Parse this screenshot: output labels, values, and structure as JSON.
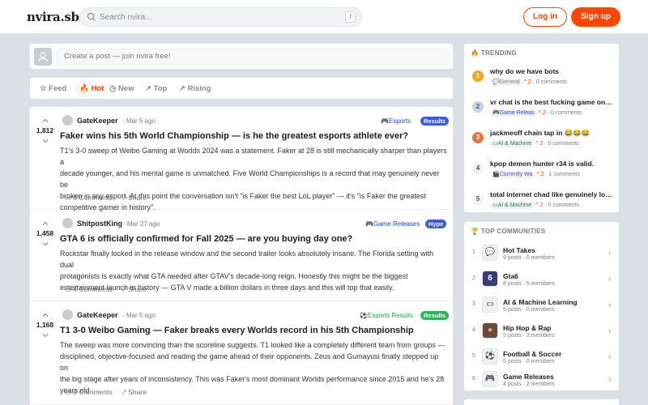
{
  "header": {
    "logo": "nvira.sbs",
    "search_placeholder": "Search nvira...",
    "search_shortcut": "/",
    "login_label": "Log in",
    "signup_label": "Sign up",
    "accent": "#ff4500"
  },
  "create_post": {
    "placeholder": "Create a post — join nvira free!"
  },
  "sort_tabs": [
    {
      "label": "Feed",
      "icon": "star-icon"
    },
    {
      "label": "Hot",
      "icon": "flame-icon",
      "active": true
    },
    {
      "label": "New",
      "icon": "clock-icon"
    },
    {
      "label": "Top",
      "icon": "trend-icon"
    },
    {
      "label": "Rising",
      "icon": "rising-icon"
    }
  ],
  "posts": [
    {
      "votes": "1,812",
      "author": "GateKeeper",
      "time": "· Mar 5 ago",
      "category": "Esports",
      "category_icon": "gamepad-icon",
      "badge": "Results",
      "badge_color": "#3b5bdb",
      "title": "Faker wins his 5th World Championship — is he the greatest esports athlete ever?",
      "body_lines": [
        "T1's 3-0 sweep of Weibo Gaming at Worlds 2024 was a statement. Faker at 28 is still mechanically sharper than players a",
        "decade younger, and his mental game is unmatched. Five World Championships is a record that may genuinely never be",
        "broken in any esport. At this point the conversation isn't \"is Faker the best LoL player\" — it's \"is Faker the greatest",
        "competitive gamer in history\"."
      ],
      "comments": "0 Comments",
      "share": "Share"
    },
    {
      "votes": "1,458",
      "author": "ShitpostKing",
      "time": "· Mar 27 ago",
      "category": "Game Releases",
      "category_icon": "gamepad-icon",
      "badge": "Hype",
      "badge_color": "#3b5bdb",
      "title": "GTA 6 is officially confirmed for Fall 2025 — are you buying day one?",
      "body_lines": [
        "Rockstar finally locked in the release window and the second trailer looks absolutely insane. The Florida setting with dual",
        "protagonists is exactly what GTA needed after GTAV's decade-long reign. Honestly this might be the biggest",
        "entertainment launch in history — GTA V made a billion dollars in three days and this will top that easily."
      ],
      "comments": "4 Comments",
      "share": "Share"
    },
    {
      "votes": "1,168",
      "author": "GateKeeper",
      "time": "· Mar 5 ago",
      "category": "Esports Results",
      "category_icon": "soccer-ball-icon",
      "badge": "Results",
      "badge_color": "#2fb35a",
      "title": "T1 3-0 Weibo Gaming — Faker breaks every Worlds record in his 5th Championship",
      "body_lines": [
        "The sweep was more convincing than the scoreline suggests. T1 looked like a completely different team from groups —",
        "disciplined, objective-focused and reading the game ahead of their opponents. Zeus and Gumayusi finally stepped up on",
        "the big stage after years of inconsistency. This was Faker's most dominant Worlds performance since 2015 and he's 28",
        "years old."
      ],
      "comments": "0 Comments",
      "share": "Share"
    }
  ],
  "trending": {
    "heading": "TRENDING",
    "items": [
      {
        "rank": "1",
        "title": "why do we have bots",
        "tag": "General",
        "tag_icon": "speech-icon",
        "score": "^ 2",
        "comments": "· 0 comments",
        "rank_bg": "#f5a623",
        "rank_fg": "#ffffff"
      },
      {
        "rank": "2",
        "title": "vr chat is the best fucking game on t...",
        "tag": "Game Releas",
        "tag_icon": "gamepad-icon",
        "score": "^ 2",
        "comments": "· 0 comments",
        "rank_bg": "#c9d3e6",
        "rank_fg": "#4a5a7a"
      },
      {
        "rank": "3",
        "title": "jackmeoff chain tap in 😂😂😂",
        "tag": "AI & Machine",
        "tag_icon": "monitor-icon",
        "score": "^ 2",
        "comments": "· 0 comments",
        "rank_bg": "#e8753a",
        "rank_fg": "#ffffff"
      },
      {
        "rank": "4",
        "title": "kpop demon hunter r34 is valid.",
        "tag": "Currently Wa",
        "tag_icon": "clapper-icon",
        "score": "^ 2",
        "comments": "· 1 comments",
        "rank_bg": "#f0f2f4",
        "rank_fg": "#555555"
      },
      {
        "rank": "5",
        "title": "total internet chad like genuinely loo...",
        "tag": "AI & Machine",
        "tag_icon": "monitor-icon",
        "score": "^ 2",
        "comments": "· 0 comments",
        "rank_bg": "#f0f2f4",
        "rank_fg": "#555555"
      }
    ]
  },
  "communities": {
    "heading": "TOP COMMUNITIES",
    "items": [
      {
        "rank": "1",
        "name": "Hot Takes",
        "meta": "9 posts · 0 members",
        "icon": "speech-bubble-icon",
        "glyph": "💬"
      },
      {
        "rank": "2",
        "name": "Gta6",
        "meta": "8 posts · 5 members",
        "icon": "gta-logo-icon",
        "glyph": "6"
      },
      {
        "rank": "3",
        "name": "AI & Machine Learning",
        "meta": "5 posts · 0 members",
        "icon": "monitor-icon",
        "glyph": "▭"
      },
      {
        "rank": "4",
        "name": "Hip Hop & Rap",
        "meta": "5 posts · 3 members",
        "icon": "avatar-photo-icon",
        "glyph": "●"
      },
      {
        "rank": "5",
        "name": "Football & Soccer",
        "meta": "5 posts · 0 members",
        "icon": "soccer-ball-icon",
        "glyph": "⚽"
      },
      {
        "rank": "6",
        "name": "Game Releases",
        "meta": "4 posts · 2 members",
        "icon": "gamepad-icon",
        "glyph": "🎮"
      }
    ]
  }
}
